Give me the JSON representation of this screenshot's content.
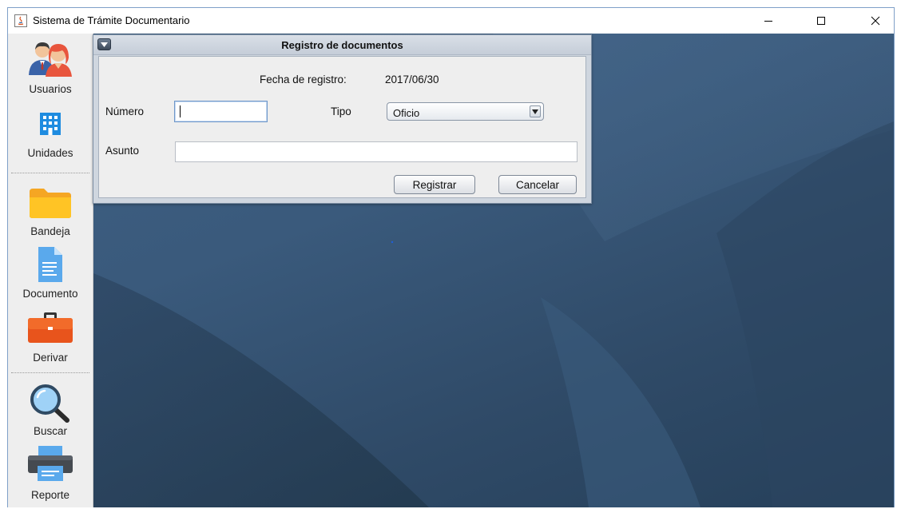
{
  "window": {
    "title": "Sistema de Trámite Documentario"
  },
  "sidebar": {
    "items": [
      {
        "label": "Usuarios",
        "icon": "users-icon"
      },
      {
        "label": "Unidades",
        "icon": "building-icon"
      },
      {
        "label": "Bandeja",
        "icon": "folder-icon"
      },
      {
        "label": "Documento",
        "icon": "document-icon"
      },
      {
        "label": "Derivar",
        "icon": "briefcase-icon"
      },
      {
        "label": "Buscar",
        "icon": "search-icon"
      },
      {
        "label": "Reporte",
        "icon": "printer-icon"
      }
    ]
  },
  "dialog": {
    "title": "Registro de documentos",
    "fecha_label": "Fecha de registro:",
    "fecha_value": "2017/06/30",
    "numero_label": "Número",
    "numero_value": "",
    "tipo_label": "Tipo",
    "tipo_value": "Oficio",
    "asunto_label": "Asunto",
    "asunto_value": "",
    "register_label": "Registrar",
    "cancel_label": "Cancelar"
  },
  "colors": {
    "desktop": "#3a5a7c",
    "sidebar": "#eeeeee",
    "dialog_frame": "#cfd6df"
  }
}
